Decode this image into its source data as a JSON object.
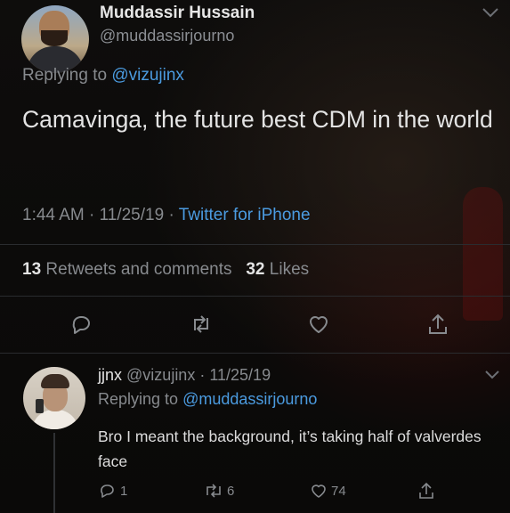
{
  "main_tweet": {
    "author_name": "Muddassir Hussain",
    "author_handle": "@muddassirjourno",
    "replying_prefix": "Replying to",
    "replying_handle": "@vizujinx",
    "text": "Camavinga, the future best CDM in the world",
    "time": "1:44 AM",
    "date": "11/25/19",
    "source": "Twitter for iPhone",
    "retweets_count": "13",
    "retweets_label": "Retweets and comments",
    "likes_count": "32",
    "likes_label": "Likes"
  },
  "reply": {
    "author_name": "jjnx",
    "author_handle": "@vizujinx",
    "date": "11/25/19",
    "replying_prefix": "Replying to",
    "replying_handle": "@muddassirjourno",
    "text": "Bro I meant the background, it’s taking half of valverdes face",
    "reply_count": "1",
    "retweet_count": "6",
    "like_count": "74"
  },
  "colors": {
    "background": "#0b0a09",
    "text": "#e3e3e3",
    "muted": "#878a8e",
    "link": "#4b9be0"
  },
  "icons": [
    "chevron-down-icon",
    "reply-icon",
    "retweet-icon",
    "heart-icon",
    "share-icon"
  ]
}
